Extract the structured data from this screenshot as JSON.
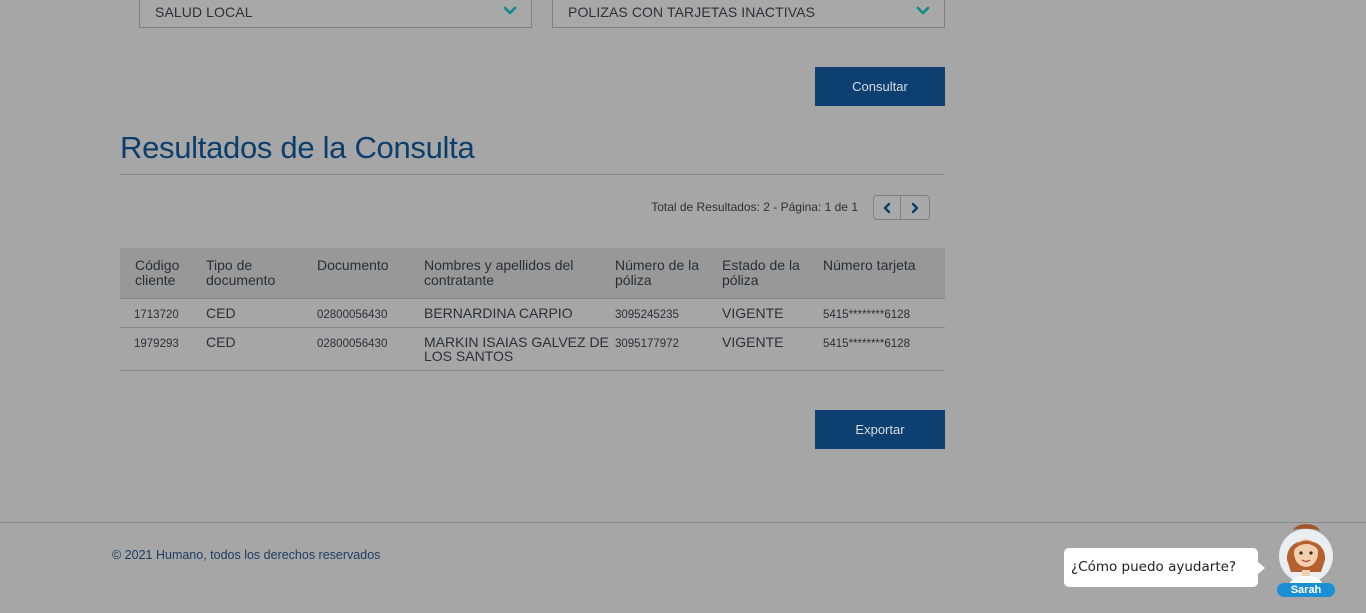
{
  "filters": {
    "product": {
      "value": "SALUD LOCAL",
      "icon": "chevron-down-icon"
    },
    "report": {
      "value": "POLIZAS CON TARJETAS INACTIVAS",
      "icon": "chevron-down-icon"
    }
  },
  "actions": {
    "consultar_label": "Consultar",
    "exportar_label": "Exportar"
  },
  "results": {
    "title": "Resultados de la Consulta",
    "pagination_text": "Total de Resultados: 2 - Página: 1 de 1",
    "prev_icon": "chevron-left-icon",
    "next_icon": "chevron-right-icon",
    "columns": [
      "Código cliente",
      "Tipo de documento",
      "Documento",
      "Nombres y apellidos del contratante",
      "Número de la póliza",
      "Estado de la póliza",
      "Número tarjeta"
    ],
    "rows": [
      [
        "1713720",
        "CED",
        "02800056430",
        "BERNARDINA CARPIO",
        "3095245235",
        "VIGENTE",
        "5415********6128"
      ],
      [
        "1979293",
        "CED",
        "02800056430",
        "MARKIN ISAIAS GALVEZ DE LOS SANTOS",
        "3095177972",
        "VIGENTE",
        "5415********6128"
      ]
    ]
  },
  "footer": {
    "copyright": "© 2021 Humano, todos los derechos reservados"
  },
  "chat": {
    "prompt": "¿Cómo puedo ayudarte?",
    "assistant_name": "Sarah"
  },
  "colors": {
    "primary": "#0d4070",
    "title": "#0b3e6d",
    "accent_chevron": "#0e8a8a",
    "chat_badge": "#1a8fd6"
  }
}
